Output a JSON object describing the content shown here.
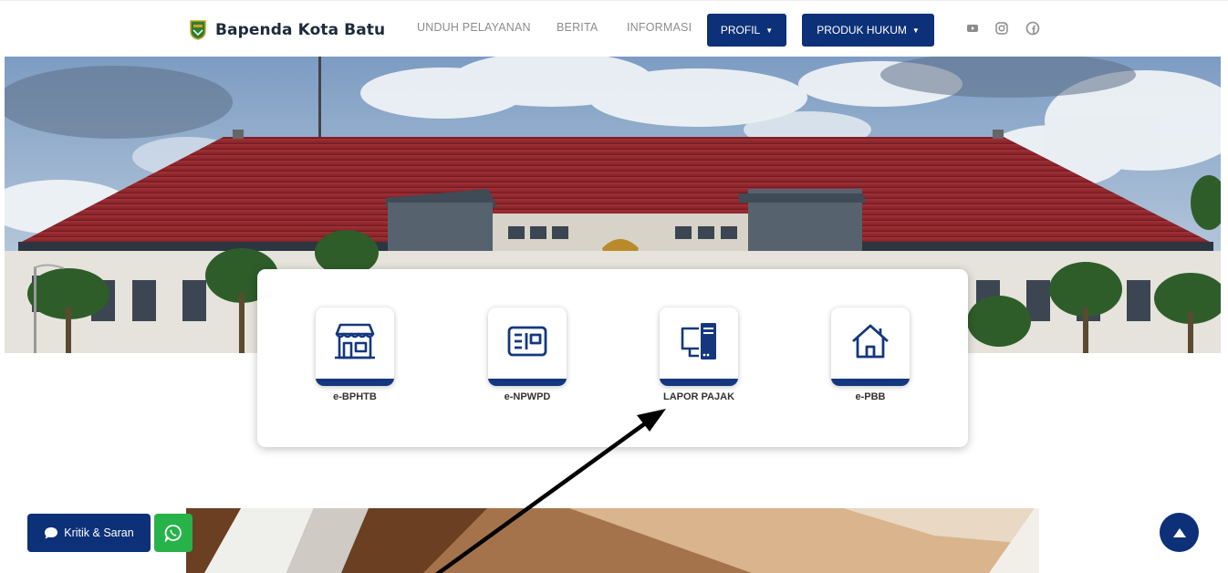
{
  "brand": {
    "name": "Bapenda Kota Batu",
    "logo_icon": "city-emblem-icon"
  },
  "nav": {
    "links": [
      "UNDUH PELAYANAN",
      "BERITA",
      "INFORMASI"
    ],
    "dropdowns": [
      "PROFIL",
      "PRODUK HUKUM"
    ],
    "social_icons": [
      "youtube-icon",
      "instagram-icon",
      "facebook-icon"
    ]
  },
  "hero": {
    "image": "government-office-building-photo"
  },
  "services": [
    {
      "label": "e-BPHTB",
      "icon": "storefront-icon"
    },
    {
      "label": "e-NPWPD",
      "icon": "id-card-icon"
    },
    {
      "label": "LAPOR PAJAK",
      "icon": "computer-icon"
    },
    {
      "label": "e-PBB",
      "icon": "house-icon"
    }
  ],
  "floating": {
    "feedback_label": "Kritik & Saran",
    "whatsapp_icon": "whatsapp-icon",
    "back_to_top_icon": "arrow-up-icon"
  },
  "colors": {
    "primary": "#0d3178",
    "whatsapp": "#27b34a",
    "roof": "#9b2a2f"
  }
}
